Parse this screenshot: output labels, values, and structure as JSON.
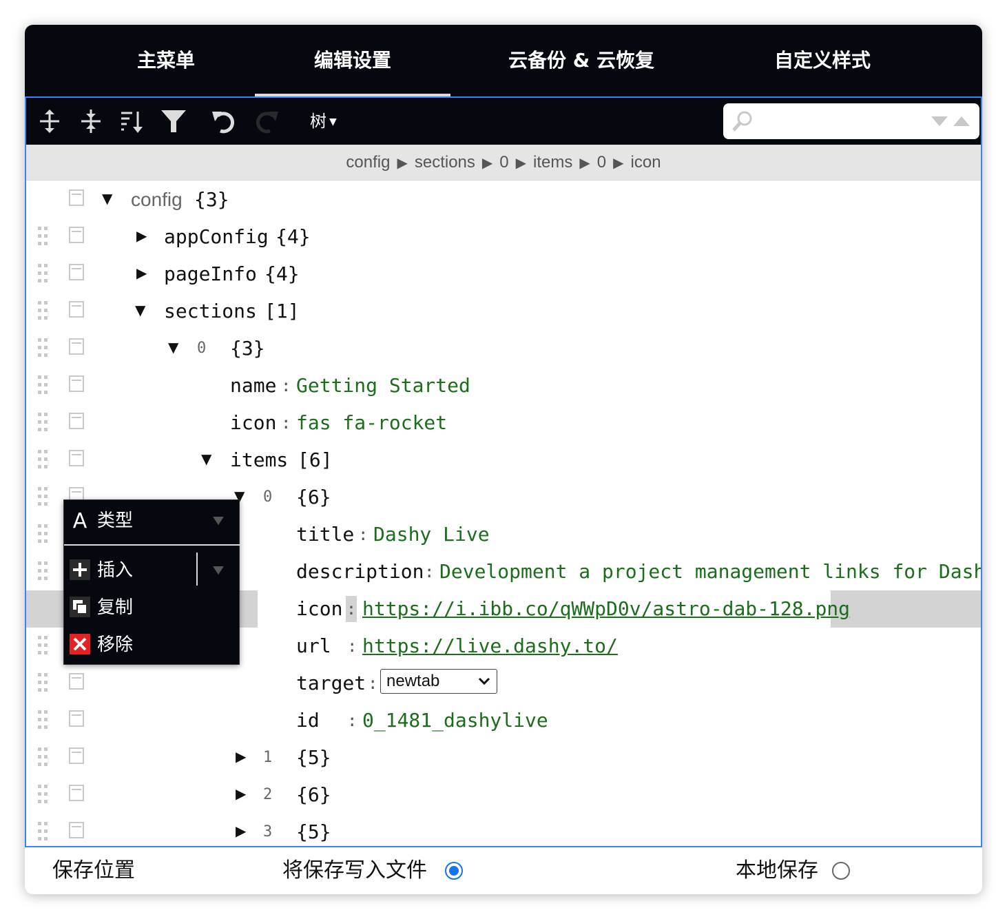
{
  "tabs": [
    {
      "label": "主菜单",
      "active": false
    },
    {
      "label": "编辑设置",
      "active": true
    },
    {
      "label": "云备份 & 云恢复",
      "active": false
    },
    {
      "label": "自定义样式",
      "active": false
    }
  ],
  "toolbar": {
    "expand_all_icon": "expand-all-icon",
    "collapse_all_icon": "collapse-all-icon",
    "sort_icon": "sort-icon",
    "filter_icon": "filter-icon",
    "undo_icon": "undo-icon",
    "redo_icon": "redo-icon",
    "mode_label": "树"
  },
  "search": {
    "placeholder": "",
    "value": ""
  },
  "breadcrumb": [
    "config",
    "sections",
    "0",
    "items",
    "0",
    "icon"
  ],
  "tree": {
    "root": {
      "field": "config",
      "count": "{3}"
    },
    "appConfig": {
      "field": "appConfig",
      "count": "{4}"
    },
    "pageInfo": {
      "field": "pageInfo",
      "count": "{4}"
    },
    "sections": {
      "field": "sections",
      "count": "[1]"
    },
    "section0": {
      "index": "0",
      "count": "{3}"
    },
    "section_name": {
      "field": "name",
      "value": "Getting Started"
    },
    "section_icon": {
      "field": "icon",
      "value": "fas fa-rocket"
    },
    "items": {
      "field": "items",
      "count": "[6]"
    },
    "item0": {
      "index": "0",
      "count": "{6}"
    },
    "item_title": {
      "field": "title",
      "value": "Dashy Live"
    },
    "item_description": {
      "field": "description",
      "value": "Development a project management links for Dashy"
    },
    "item_icon": {
      "field": "icon",
      "value": "https://i.ibb.co/qWWpD0v/astro-dab-128.png"
    },
    "item_url": {
      "field": "url",
      "value": "https://live.dashy.to/"
    },
    "item_target": {
      "field": "target",
      "value": "newtab"
    },
    "item_id": {
      "field": "id",
      "value": "0_1481_dashylive"
    },
    "item1": {
      "index": "1",
      "count": "{5}"
    },
    "item2": {
      "index": "2",
      "count": "{6}"
    },
    "item3": {
      "index": "3",
      "count": "{5}"
    }
  },
  "context_menu": {
    "type_label": "类型",
    "insert_label": "插入",
    "duplicate_label": "复制",
    "remove_label": "移除"
  },
  "footer": {
    "label": "保存位置",
    "option_file": "将保存写入文件",
    "option_local": "本地保存",
    "selected": "file"
  },
  "colors": {
    "accent": "#3883fa",
    "dark_bg": "#05080f",
    "value_green": "#1a6e1a",
    "remove_red": "#e52121",
    "radio_blue": "#1a73e8"
  }
}
